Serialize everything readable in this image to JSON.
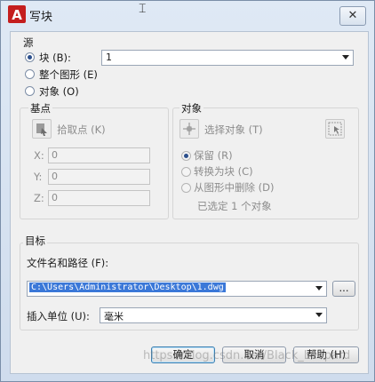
{
  "window": {
    "title": "写块",
    "app_icon_letter": "A",
    "close_glyph": "✕",
    "accent": "#c41e1e"
  },
  "source": {
    "heading": "源",
    "options": [
      "块 (B):",
      "整个图形 (E)",
      "对象 (O)"
    ],
    "selected": "块 (B):",
    "block_name": "1"
  },
  "base_point": {
    "heading": "基点",
    "pick_label": "拾取点 (K)",
    "x_label": "X:",
    "x_value": "0",
    "y_label": "Y:",
    "y_value": "0",
    "z_label": "Z:",
    "z_value": "0"
  },
  "objects": {
    "heading": "对象",
    "select_label": "选择对象 (T)",
    "options": [
      "保留 (R)",
      "转换为块 (C)",
      "从图形中删除 (D)"
    ],
    "selected": "保留 (R)",
    "status": "已选定 1 个对象"
  },
  "target": {
    "heading": "目标",
    "path_label": "文件名和路径 (F):",
    "path_value": "C:\\Users\\Administrator\\Desktop\\1.dwg",
    "browse_label": "...",
    "unit_label": "插入单位 (U):",
    "unit_value": "毫米"
  },
  "buttons": {
    "ok": "确定",
    "cancel": "取消",
    "help": "帮助 (H)"
  },
  "watermark": "https://blog.csdn.net/Black_Leopard",
  "cursor": "⌶"
}
